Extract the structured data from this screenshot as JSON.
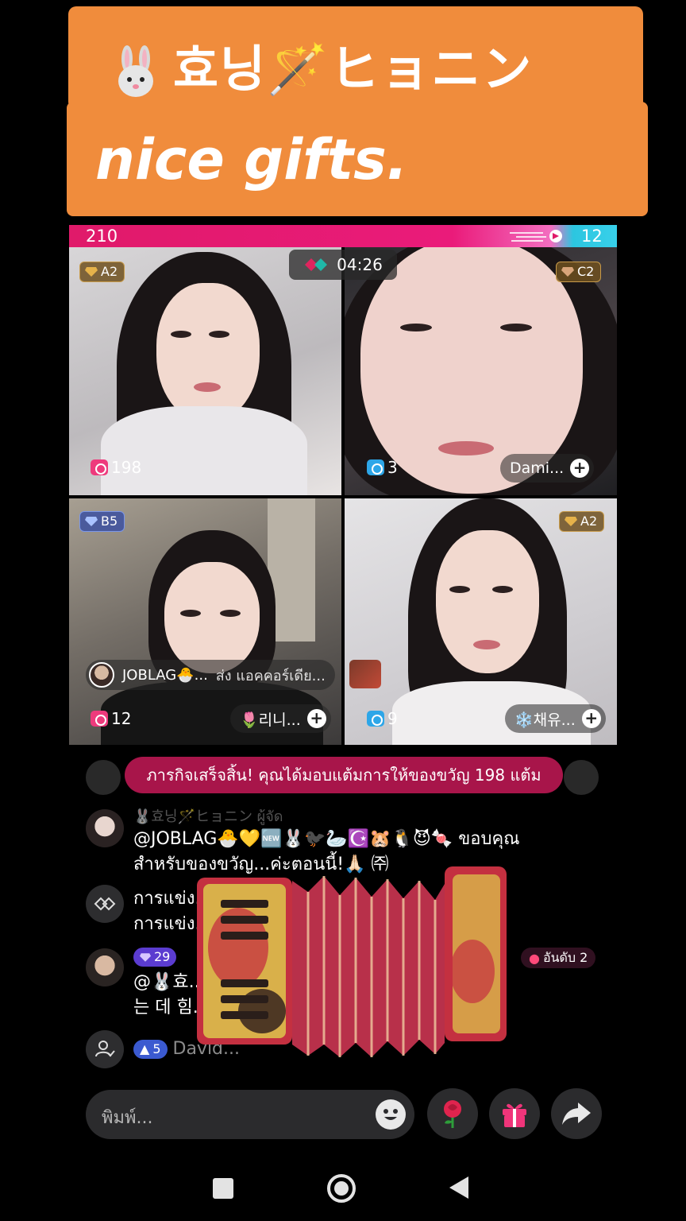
{
  "banner": {
    "title": "효닝🪄ヒョニン",
    "subtitle": "nice gifts."
  },
  "battle": {
    "score_left": "210",
    "score_right": "12",
    "timer": "04:26"
  },
  "tiles": [
    {
      "rank": "A2",
      "viewers": "198",
      "name": ""
    },
    {
      "rank": "C2",
      "viewers": "3",
      "name": "Dami..."
    },
    {
      "rank": "B5",
      "viewers": "12",
      "name": "🌷리니..."
    },
    {
      "rank": "A2",
      "viewers": "9",
      "name": "❄️채유..."
    }
  ],
  "gift_strip": {
    "user": "JOBLAG🐣...",
    "text": "ส่ง แอคคอร์เดีย..."
  },
  "toast": {
    "text": "ภารกิจเสร็จสิ้น! คุณได้มอบแต้มการให้ของขวัญ 198 แต้ม"
  },
  "chat": {
    "msg1_header": "🐰효닝🪄ヒョニン ผู้จัด",
    "msg1_line1": "@JOBLAG🐣💛🆕🐰🐦‍⬛🦢☪️🐹🐧😈🍬 ขอบคุณ",
    "msg1_line2": "สำหรับของขวัญ...ค่ะตอนนี้!🙏🏻 ㈜",
    "msg2_line1": "การแข่ง...                                         อร์ กดถูกใจ",
    "msg2_line2": "การแข่ง...",
    "msg3_badge": "29",
    "msg3_rank": "อันดับ 2",
    "msg3_line1": "@🐰효...                                      ...면 저도 싸우",
    "msg3_line2": "는 데 힘...",
    "msg4_badge": "5",
    "msg4_text": "David..."
  },
  "input": {
    "placeholder": "พิมพ์..."
  },
  "colors": {
    "banner": "#f08c3c",
    "battle_pink": "#e01a6a",
    "battle_cyan": "#38d0ea",
    "toast": "#a8154a"
  }
}
